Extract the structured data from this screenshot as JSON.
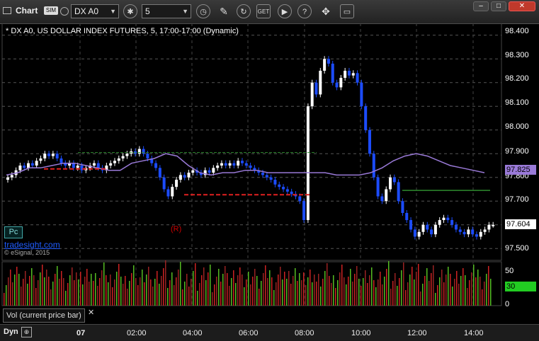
{
  "toolbar": {
    "app_label": "Chart",
    "sim_badge": "SIM",
    "symbol": "DX A0",
    "interval": "5",
    "gear_label": "gear",
    "clock_label": "clock"
  },
  "chart": {
    "header": "* DX A0, US DOLLAR INDEX FUTURES, 5, 17:00-17:00 (Dynamic)",
    "watermark": "tradesight.com",
    "copyright": "© eSignal, 2015",
    "pc_button": "Pc",
    "reversal_marker": "(R)",
    "price_labels": [
      "98.400",
      "98.300",
      "98.200",
      "98.100",
      "98.000",
      "97.900",
      "97.800",
      "97.700",
      "97.500"
    ],
    "ma_price": "97.825",
    "last_price": "97.604",
    "time_labels": [
      "07",
      "02:00",
      "04:00",
      "06:00",
      "08:00",
      "10:00",
      "12:00",
      "14:00"
    ],
    "colors": {
      "up": "#ffffff",
      "down": "#1c4cff",
      "ma": "#9a7ad8",
      "green_line": "#2e8b2e",
      "red_line": "#e02020",
      "count": "#33cc33"
    }
  },
  "volume": {
    "panel_label": "Vol (current price bar)",
    "scale_labels": [
      "50",
      "30",
      "0"
    ],
    "current": "30"
  },
  "status": {
    "dyn": "Dyn"
  },
  "chart_data": {
    "type": "candlestick",
    "title": "* DX A0, US DOLLAR INDEX FUTURES, 5, 17:00-17:00 (Dynamic)",
    "xlabel": "",
    "ylabel": "",
    "ylim": [
      97.45,
      98.45
    ],
    "x_ticks": [
      "07",
      "02:00",
      "04:00",
      "06:00",
      "08:00",
      "10:00",
      "12:00",
      "14:00"
    ],
    "close": [
      97.8,
      97.81,
      97.83,
      97.85,
      97.84,
      97.86,
      97.85,
      97.87,
      97.88,
      97.9,
      97.89,
      97.9,
      97.88,
      97.86,
      97.85,
      97.86,
      97.84,
      97.85,
      97.83,
      97.84,
      97.85,
      97.86,
      97.84,
      97.83,
      97.85,
      97.86,
      97.87,
      97.88,
      97.89,
      97.9,
      97.91,
      97.9,
      97.92,
      97.9,
      97.88,
      97.86,
      97.84,
      97.8,
      97.75,
      97.72,
      97.76,
      97.79,
      97.81,
      97.8,
      97.82,
      97.83,
      97.82,
      97.81,
      97.83,
      97.82,
      97.84,
      97.85,
      97.86,
      97.85,
      97.86,
      97.85,
      97.87,
      97.86,
      97.85,
      97.84,
      97.83,
      97.82,
      97.81,
      97.8,
      97.79,
      97.77,
      97.76,
      97.75,
      97.74,
      97.73,
      97.72,
      97.7,
      97.62,
      98.1,
      98.2,
      98.15,
      98.25,
      98.3,
      98.28,
      98.2,
      98.18,
      98.22,
      98.25,
      98.23,
      98.24,
      98.2,
      98.1,
      98.0,
      97.9,
      97.8,
      97.72,
      97.7,
      97.75,
      97.8,
      97.78,
      97.7,
      97.65,
      97.62,
      97.58,
      97.55,
      97.57,
      97.6,
      97.58,
      97.56,
      97.6,
      97.62,
      97.63,
      97.62,
      97.6,
      97.58,
      97.57,
      97.56,
      97.58,
      97.56,
      97.55,
      97.57,
      97.58,
      97.6,
      97.6
    ],
    "moving_average": [
      97.81,
      97.82,
      97.84,
      97.84,
      97.85,
      97.86,
      97.86,
      97.85,
      97.84,
      97.83,
      97.83,
      97.86,
      97.87,
      97.88,
      97.9,
      97.89,
      97.85,
      97.82,
      97.81,
      97.82,
      97.82,
      97.83,
      97.83,
      97.82,
      97.82,
      97.82,
      97.82,
      97.82,
      97.82,
      97.81,
      97.81,
      97.81,
      97.82,
      97.84,
      97.87,
      97.89,
      97.9,
      97.89,
      97.87,
      97.85,
      97.84,
      97.83,
      97.82
    ],
    "volume_scale": [
      0,
      50
    ],
    "volume_current": 30
  }
}
